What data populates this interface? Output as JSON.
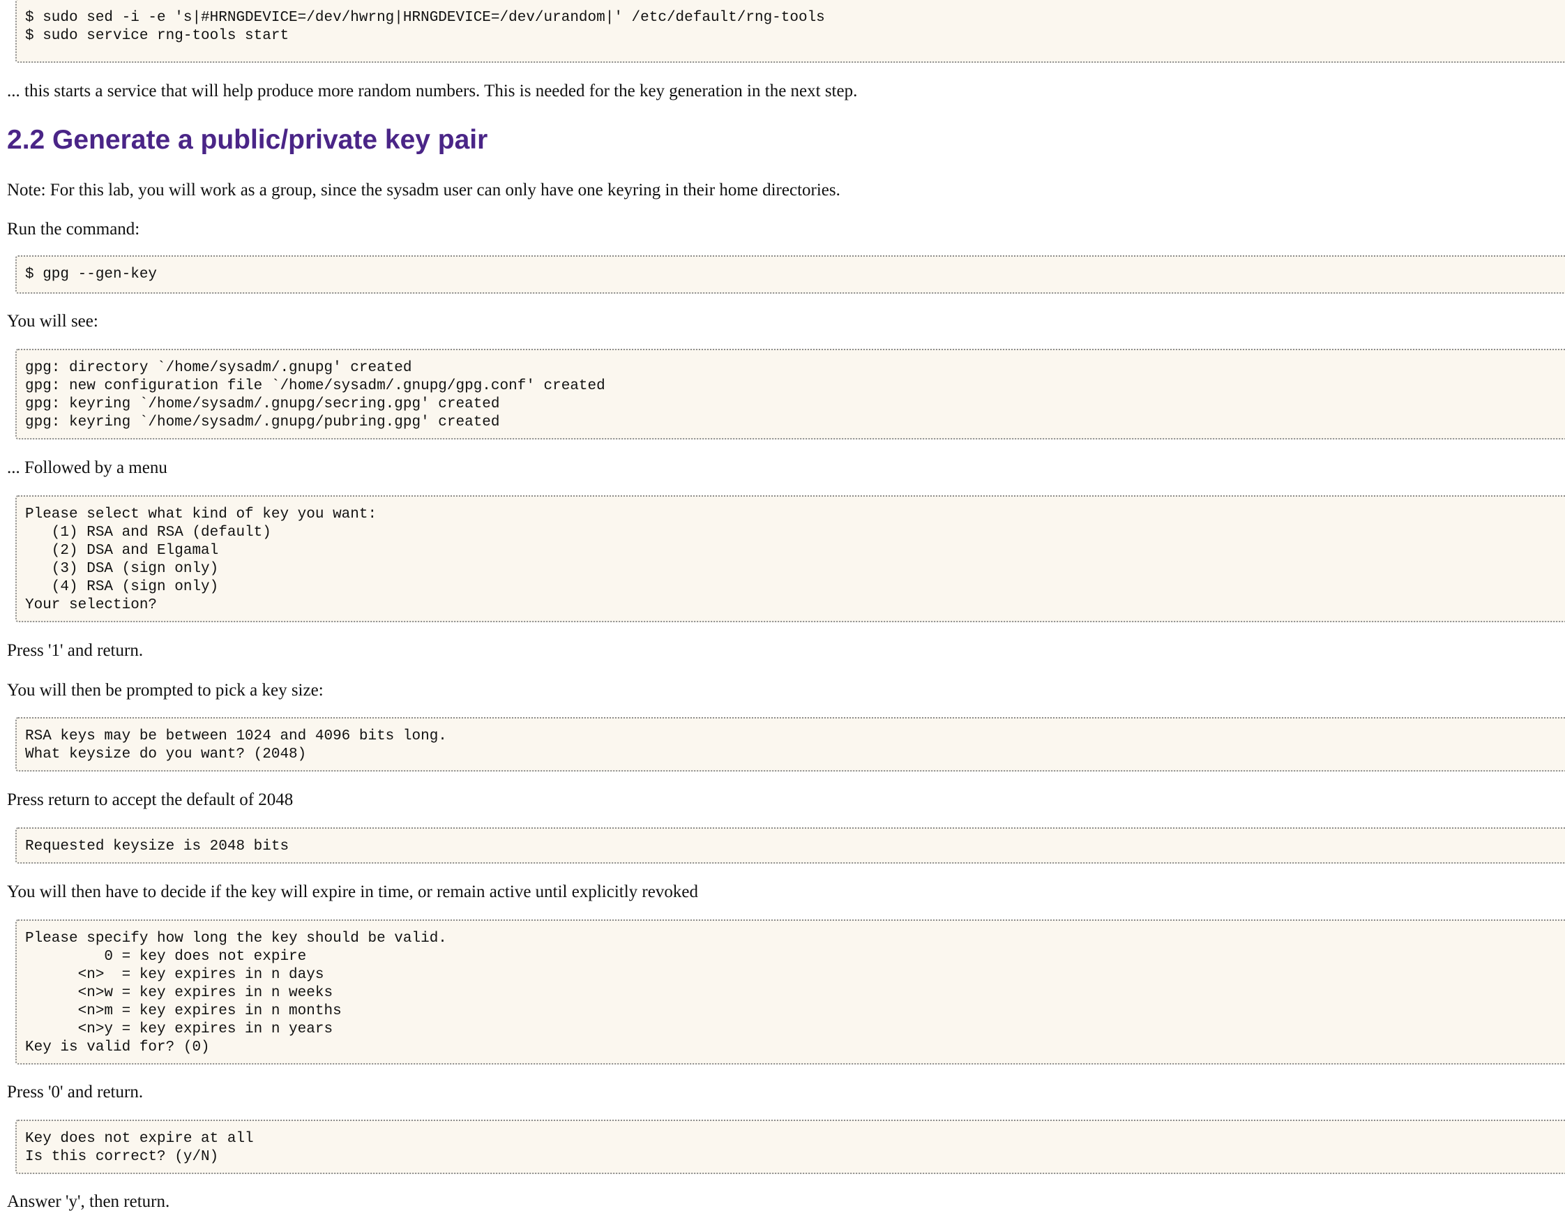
{
  "code_blocks": {
    "rng_tools": "$ sudo sed -i -e 's|#HRNGDEVICE=/dev/hwrng|HRNGDEVICE=/dev/urandom|' /etc/default/rng-tools\n$ sudo service rng-tools start",
    "gen_key_cmd": "$ gpg --gen-key",
    "gpg_created": "gpg: directory `/home/sysadm/.gnupg' created\ngpg: new configuration file `/home/sysadm/.gnupg/gpg.conf' created\ngpg: keyring `/home/sysadm/.gnupg/secring.gpg' created\ngpg: keyring `/home/sysadm/.gnupg/pubring.gpg' created",
    "key_kind_menu": "Please select what kind of key you want:\n   (1) RSA and RSA (default)\n   (2) DSA and Elgamal\n   (3) DSA (sign only)\n   (4) RSA (sign only)\nYour selection?",
    "key_size_prompt": "RSA keys may be between 1024 and 4096 bits long.\nWhat keysize do you want? (2048)",
    "key_size_result": "Requested keysize is 2048 bits",
    "validity_prompt": "Please specify how long the key should be valid.\n         0 = key does not expire\n      <n>  = key expires in n days\n      <n>w = key expires in n weeks\n      <n>m = key expires in n months\n      <n>y = key expires in n years\nKey is valid for? (0)",
    "confirm_prompt": "Key does not expire at all\nIs this correct? (y/N)"
  },
  "paragraphs": {
    "rng_explanation": "... this starts a service that will help produce more random numbers. This is needed for the key generation in the next step.",
    "group_note": "Note: For this lab, you will work as a group, since the sysadm user can only have one keyring in their home directories.",
    "run_command": "Run the command:",
    "you_will_see": "You will see:",
    "followed_by_menu": "... Followed by a menu",
    "press_1": "Press '1' and return.",
    "pick_key_size": "You will then be prompted to pick a key size:",
    "accept_default": "Press return to accept the default of 2048",
    "decide_expire": "You will then have to decide if the key will expire in time, or remain active until explicitly revoked",
    "press_0": "Press '0' and return.",
    "answer_y": "Answer 'y', then return."
  },
  "headings": {
    "section": "2.2 Generate a public/private key pair"
  },
  "colors": {
    "heading": "#4a2587",
    "code_background": "#fbf7ef",
    "code_border": "#8c8c8c"
  }
}
